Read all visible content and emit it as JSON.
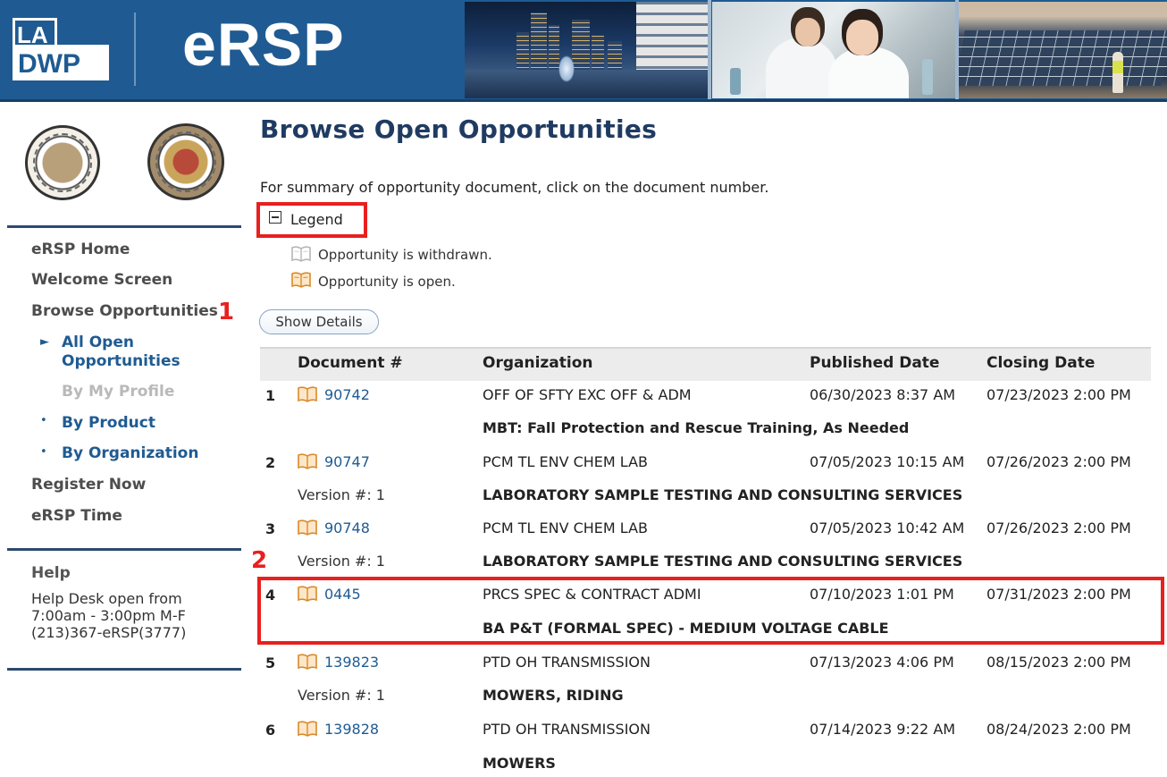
{
  "header": {
    "logo_line1": "LA",
    "logo_line2": "DWP",
    "app_title": "eRSP"
  },
  "sidebar": {
    "nav": [
      {
        "label": "eRSP Home"
      },
      {
        "label": "Welcome Screen"
      },
      {
        "label": "Browse Opportunities"
      },
      {
        "label": "All Open Opportunities"
      },
      {
        "label": "By My Profile"
      },
      {
        "label": "By Product"
      },
      {
        "label": "By Organization"
      },
      {
        "label": "Register Now"
      },
      {
        "label": "eRSP Time"
      }
    ],
    "annotation_1": "1",
    "help": {
      "title": "Help",
      "line1": "Help Desk open from",
      "line2": "7:00am - 3:00pm M-F",
      "line3": "(213)367-eRSP(3777)"
    }
  },
  "main": {
    "title": "Browse Open Opportunities",
    "instructions": "For summary of opportunity document, click on the document number.",
    "legend": {
      "label": "Legend",
      "withdrawn": "Opportunity is withdrawn.",
      "open": "Opportunity is open."
    },
    "show_details_label": "Show Details",
    "annotation_2": "2",
    "table": {
      "headers": [
        "Document #",
        "Organization",
        "Published Date",
        "Closing Date"
      ],
      "rows": [
        {
          "num": "1",
          "doc": "90742",
          "org": "OFF OF SFTY EXC OFF & ADM",
          "published": "06/30/2023 8:37 AM",
          "closing": "07/23/2023 2:00 PM",
          "version": "",
          "description": "MBT: Fall Protection and Rescue Training, As Needed"
        },
        {
          "num": "2",
          "doc": "90747",
          "org": "PCM TL ENV CHEM LAB",
          "published": "07/05/2023 10:15 AM",
          "closing": "07/26/2023 2:00 PM",
          "version": "Version #: 1",
          "description": "LABORATORY SAMPLE TESTING AND CONSULTING SERVICES"
        },
        {
          "num": "3",
          "doc": "90748",
          "org": "PCM TL ENV CHEM LAB",
          "published": "07/05/2023 10:42 AM",
          "closing": "07/26/2023 2:00 PM",
          "version": "Version #: 1",
          "description": "LABORATORY SAMPLE TESTING AND CONSULTING SERVICES"
        },
        {
          "num": "4",
          "doc": "0445",
          "org": "PRCS SPEC & CONTRACT ADMI",
          "published": "07/10/2023 1:01 PM",
          "closing": "07/31/2023 2:00 PM",
          "version": "",
          "description": "BA P&T (FORMAL SPEC) - MEDIUM VOLTAGE CABLE"
        },
        {
          "num": "5",
          "doc": "139823",
          "org": "PTD OH TRANSMISSION",
          "published": "07/13/2023 4:06 PM",
          "closing": "08/15/2023 2:00 PM",
          "version": "Version #: 1",
          "description": "MOWERS, RIDING"
        },
        {
          "num": "6",
          "doc": "139828",
          "org": "PTD OH TRANSMISSION",
          "published": "07/14/2023 9:22 AM",
          "closing": "08/24/2023 2:00 PM",
          "version": "",
          "description": "MOWERS"
        }
      ]
    }
  },
  "colors": {
    "brand_blue": "#1f5b92",
    "title_navy": "#203b62",
    "highlight_red": "#e8201f",
    "open_icon": "#d98a2b",
    "withdrawn_icon": "#b5b5b5"
  }
}
